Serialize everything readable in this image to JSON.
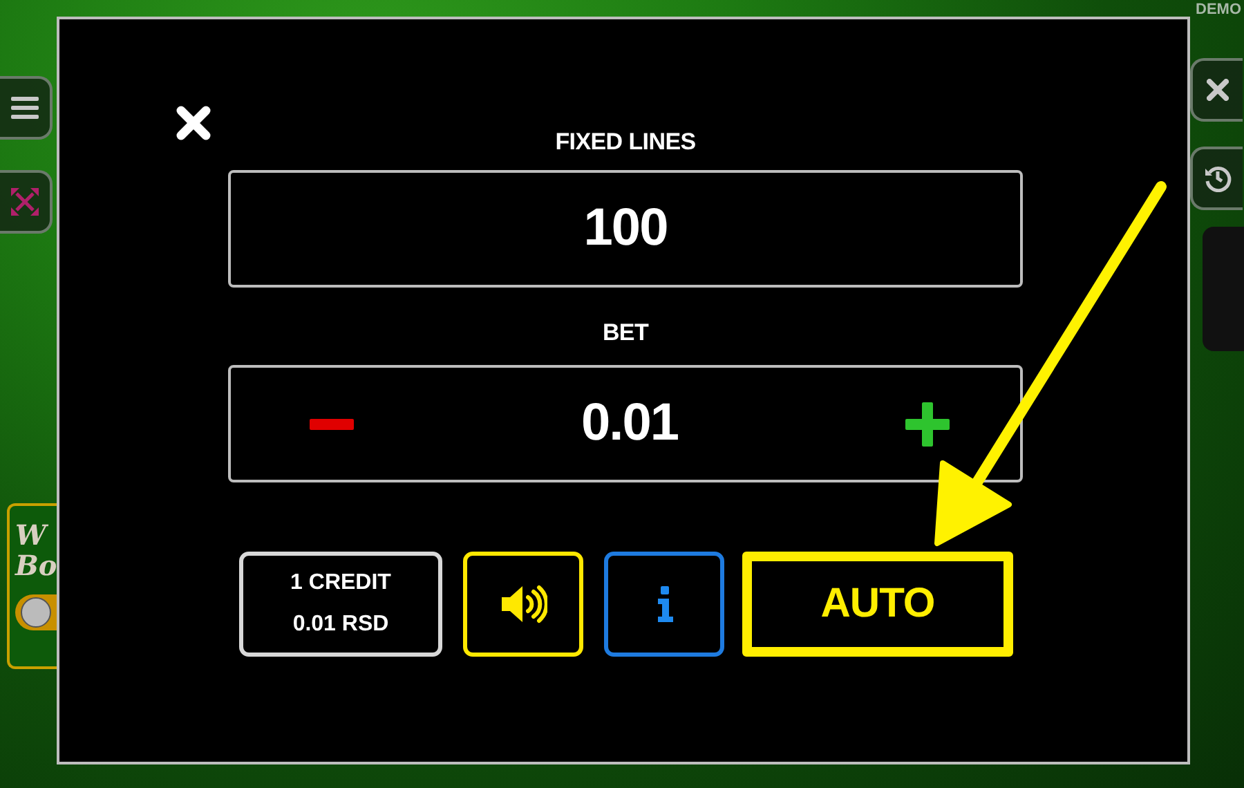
{
  "backdrop": {
    "badge": "DEMO",
    "bonus_panel": {
      "title_lines": [
        "W",
        "Bo"
      ],
      "toggle_on": false
    }
  },
  "dialog": {
    "fixed_lines": {
      "label": "FIXED LINES",
      "value": "100"
    },
    "bet": {
      "label": "BET",
      "value": "0.01"
    },
    "buttons": [
      {
        "kind": "credit",
        "lines": [
          "1 CREDIT",
          "0.01 RSD"
        ],
        "highlighted": false
      },
      {
        "kind": "sound",
        "highlighted": false
      },
      {
        "kind": "info",
        "highlighted": false
      },
      {
        "kind": "auto",
        "label": "AUTO",
        "highlighted": true
      }
    ]
  }
}
